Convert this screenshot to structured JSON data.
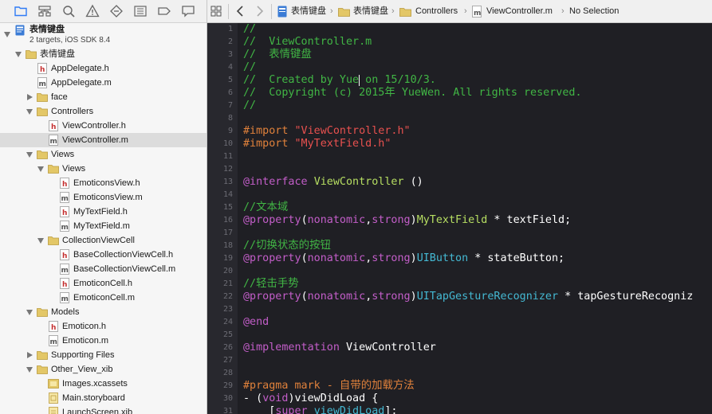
{
  "colors": {
    "comment": "#41b645",
    "preprocessor": "#e0813b",
    "string": "#e8514f",
    "keyword": "#c35ec9",
    "class_name": "#44b8d2",
    "project_class": "#b7df62",
    "editor_bg": "#1f1f24",
    "folder": "#e3c767"
  },
  "navigator": {
    "toolbar_icons": [
      "folder-icon",
      "hierarchy-icon",
      "search-icon",
      "warning-icon",
      "test-icon",
      "debug-icon",
      "breakpoint-icon",
      "log-icon"
    ],
    "project": {
      "name": "表情键盘",
      "subtitle": "2 targets, iOS SDK 8.4"
    },
    "items": [
      {
        "label": "表情键盘",
        "kind": "folder",
        "disclosure": "open"
      },
      {
        "label": "AppDelegate.h",
        "kind": "h"
      },
      {
        "label": "AppDelegate.m",
        "kind": "m"
      },
      {
        "label": "face",
        "kind": "folder",
        "disclosure": "closed"
      },
      {
        "label": "Controllers",
        "kind": "folder",
        "disclosure": "open"
      },
      {
        "label": "ViewController.h",
        "kind": "h"
      },
      {
        "label": "ViewController.m",
        "kind": "m",
        "selected": true
      },
      {
        "label": "Views",
        "kind": "folder",
        "disclosure": "open"
      },
      {
        "label": "Views",
        "kind": "folder",
        "disclosure": "open"
      },
      {
        "label": "EmoticonsView.h",
        "kind": "h"
      },
      {
        "label": "EmoticonsView.m",
        "kind": "m"
      },
      {
        "label": "MyTextField.h",
        "kind": "h"
      },
      {
        "label": "MyTextField.m",
        "kind": "m"
      },
      {
        "label": "CollectionViewCell",
        "kind": "folder",
        "disclosure": "open"
      },
      {
        "label": "BaseCollectionViewCell.h",
        "kind": "h"
      },
      {
        "label": "BaseCollectionViewCell.m",
        "kind": "m"
      },
      {
        "label": "EmoticonCell.h",
        "kind": "h"
      },
      {
        "label": "EmoticonCell.m",
        "kind": "m"
      },
      {
        "label": "Models",
        "kind": "folder",
        "disclosure": "open"
      },
      {
        "label": "Emoticon.h",
        "kind": "h"
      },
      {
        "label": "Emoticon.m",
        "kind": "m"
      },
      {
        "label": "Supporting Files",
        "kind": "folder",
        "disclosure": "closed"
      },
      {
        "label": "Other_View_xib",
        "kind": "folder",
        "disclosure": "open"
      },
      {
        "label": "Images.xcassets",
        "kind": "assets"
      },
      {
        "label": "Main.storyboard",
        "kind": "storyboard"
      },
      {
        "label": "LaunchScreen.xib",
        "kind": "xib"
      }
    ]
  },
  "jumpbar": {
    "crumbs": [
      "表情键盘",
      "表情键盘",
      "Controllers",
      "ViewController.m",
      "No Selection"
    ]
  },
  "editor": {
    "caret": {
      "line": 5,
      "column": 18
    },
    "lines": [
      {
        "n": "1",
        "tokens": [
          {
            "t": "//",
            "c": "com"
          }
        ]
      },
      {
        "n": "2",
        "tokens": [
          {
            "t": "//  ViewController.m",
            "c": "com"
          }
        ]
      },
      {
        "n": "3",
        "tokens": [
          {
            "t": "//  表情键盘",
            "c": "com"
          }
        ]
      },
      {
        "n": "4",
        "tokens": [
          {
            "t": "//",
            "c": "com"
          }
        ]
      },
      {
        "n": "5",
        "tokens": [
          {
            "t": "//  Created by Yue on 15/10/3.",
            "c": "com"
          }
        ]
      },
      {
        "n": "6",
        "tokens": [
          {
            "t": "//  Copyright (c) 2015年 YueWen. All rights reserved.",
            "c": "com"
          }
        ]
      },
      {
        "n": "7",
        "tokens": [
          {
            "t": "//",
            "c": "com"
          }
        ]
      },
      {
        "n": "8",
        "tokens": []
      },
      {
        "n": "9",
        "tokens": [
          {
            "t": "#import ",
            "c": "pp"
          },
          {
            "t": "\"ViewController.h\"",
            "c": "str"
          }
        ]
      },
      {
        "n": "10",
        "tokens": [
          {
            "t": "#import ",
            "c": "pp"
          },
          {
            "t": "\"MyTextField.h\"",
            "c": "str"
          }
        ]
      },
      {
        "n": "11",
        "tokens": []
      },
      {
        "n": "12",
        "tokens": []
      },
      {
        "n": "13",
        "tokens": [
          {
            "t": "@interface",
            "c": "kw"
          },
          {
            "t": " ",
            "c": "plain"
          },
          {
            "t": "ViewController",
            "c": "cls2"
          },
          {
            "t": " ()",
            "c": "plain"
          }
        ]
      },
      {
        "n": "14",
        "tokens": []
      },
      {
        "n": "15",
        "tokens": [
          {
            "t": "//文本域",
            "c": "com"
          }
        ]
      },
      {
        "n": "16",
        "tokens": [
          {
            "t": "@property",
            "c": "kw"
          },
          {
            "t": "(",
            "c": "plain"
          },
          {
            "t": "nonatomic",
            "c": "kw"
          },
          {
            "t": ",",
            "c": "plain"
          },
          {
            "t": "strong",
            "c": "kw"
          },
          {
            "t": ")",
            "c": "plain"
          },
          {
            "t": "MyTextField",
            "c": "cls2"
          },
          {
            "t": " * textField;",
            "c": "plain"
          }
        ]
      },
      {
        "n": "17",
        "tokens": []
      },
      {
        "n": "18",
        "tokens": [
          {
            "t": "//切换状态的按钮",
            "c": "com"
          }
        ]
      },
      {
        "n": "19",
        "tokens": [
          {
            "t": "@property",
            "c": "kw"
          },
          {
            "t": "(",
            "c": "plain"
          },
          {
            "t": "nonatomic",
            "c": "kw"
          },
          {
            "t": ",",
            "c": "plain"
          },
          {
            "t": "strong",
            "c": "kw"
          },
          {
            "t": ")",
            "c": "plain"
          },
          {
            "t": "UIButton",
            "c": "cls"
          },
          {
            "t": " * stateButton;",
            "c": "plain"
          }
        ]
      },
      {
        "n": "20",
        "tokens": []
      },
      {
        "n": "21",
        "tokens": [
          {
            "t": "//轻击手势",
            "c": "com"
          }
        ]
      },
      {
        "n": "22",
        "tokens": [
          {
            "t": "@property",
            "c": "kw"
          },
          {
            "t": "(",
            "c": "plain"
          },
          {
            "t": "nonatomic",
            "c": "kw"
          },
          {
            "t": ",",
            "c": "plain"
          },
          {
            "t": "strong",
            "c": "kw"
          },
          {
            "t": ")",
            "c": "plain"
          },
          {
            "t": "UITapGestureRecognizer",
            "c": "cls"
          },
          {
            "t": " * tapGestureRecogniz",
            "c": "plain"
          }
        ]
      },
      {
        "n": "23",
        "tokens": []
      },
      {
        "n": "24",
        "tokens": [
          {
            "t": "@end",
            "c": "kw"
          }
        ]
      },
      {
        "n": "25",
        "tokens": []
      },
      {
        "n": "26",
        "tokens": [
          {
            "t": "@implementation",
            "c": "kw"
          },
          {
            "t": " ViewController",
            "c": "plain"
          }
        ]
      },
      {
        "n": "27",
        "tokens": []
      },
      {
        "n": "28",
        "tokens": []
      },
      {
        "n": "29",
        "tokens": [
          {
            "t": "#pragma mark - 自带的加载方法",
            "c": "pp"
          }
        ]
      },
      {
        "n": "30",
        "tokens": [
          {
            "t": "- (",
            "c": "plain"
          },
          {
            "t": "void",
            "c": "kw"
          },
          {
            "t": ")viewDidLoad {",
            "c": "plain"
          }
        ]
      },
      {
        "n": "31",
        "tokens": [
          {
            "t": "    [",
            "c": "plain"
          },
          {
            "t": "super",
            "c": "kw"
          },
          {
            "t": " ",
            "c": "plain"
          },
          {
            "t": "viewDidLoad",
            "c": "cls"
          },
          {
            "t": "];",
            "c": "plain"
          }
        ]
      }
    ]
  }
}
